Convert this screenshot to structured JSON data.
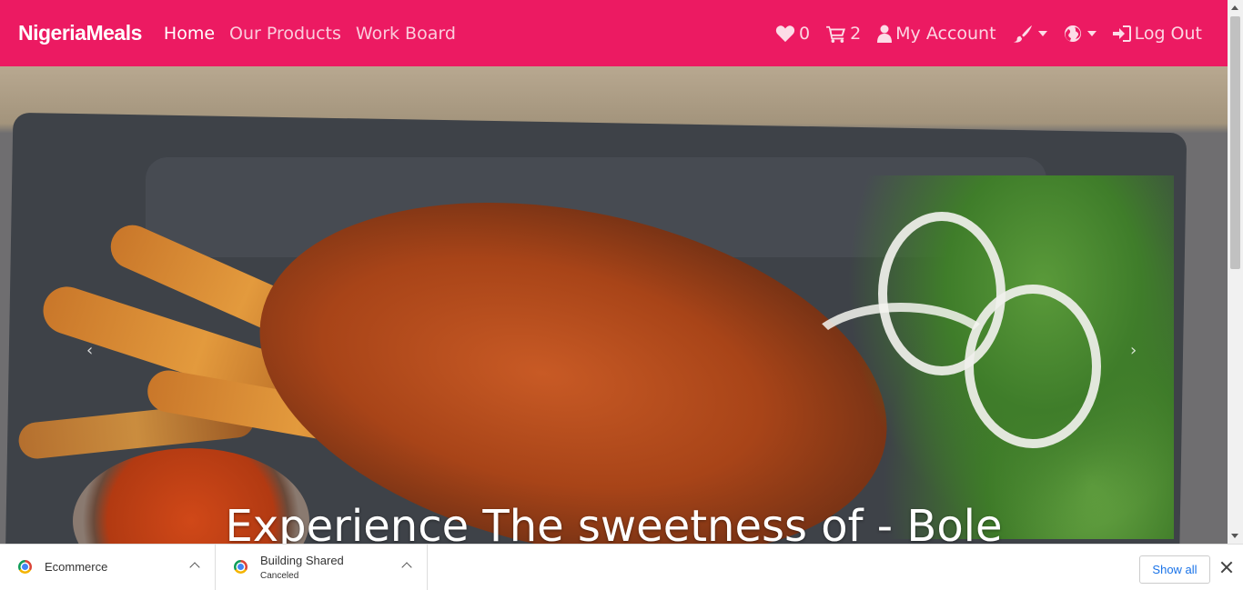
{
  "navbar": {
    "brand": "NigeriaMeals",
    "links": [
      {
        "label": "Home",
        "active": true
      },
      {
        "label": "Our Products",
        "active": false
      },
      {
        "label": "Work Board",
        "active": false
      }
    ],
    "wishlist_count": "0",
    "cart_count": "2",
    "account_label": "My Account",
    "logout_label": "Log Out",
    "theme_icon": "paintbrush-icon",
    "language_icon": "globe-icon"
  },
  "hero": {
    "caption": "Experience The sweetness of - Bole",
    "prev_icon": "chevron-left-icon",
    "next_icon": "chevron-right-icon",
    "prev_glyph": "‹",
    "next_glyph": "›"
  },
  "downloads": {
    "items": [
      {
        "name": "Ecommerce",
        "status": ""
      },
      {
        "name": "Building Shared",
        "status": "Canceled"
      }
    ],
    "show_all_label": "Show all"
  },
  "colors": {
    "brand": "#ec1a62",
    "link": "#1a73e8"
  }
}
